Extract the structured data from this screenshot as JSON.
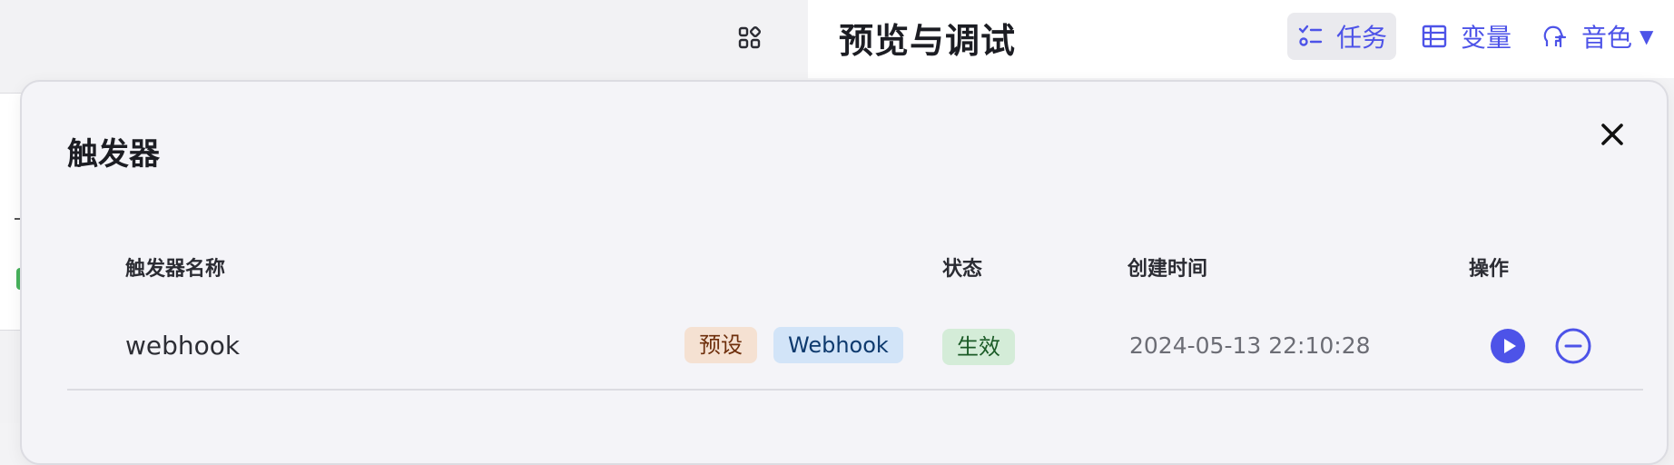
{
  "header": {
    "title": "预览与调试",
    "tools": [
      {
        "label": "任务",
        "icon": "task-list-icon"
      },
      {
        "label": "变量",
        "icon": "table-icon"
      },
      {
        "label": "音色",
        "icon": "voice-icon"
      }
    ]
  },
  "modal": {
    "title": "触发器",
    "columns": {
      "name": "触发器名称",
      "status": "状态",
      "created": "创建时间",
      "actions": "操作"
    },
    "rows": [
      {
        "name": "webhook",
        "tags": [
          "预设",
          "Webhook"
        ],
        "status": "生效",
        "created": "2024-05-13 22:10:28"
      }
    ]
  },
  "colors": {
    "accent": "#4d53e8",
    "tag_preset_bg": "#f5e1d2",
    "tag_webhook_bg": "#d2e4f8",
    "status_bg": "#d4ecd8"
  }
}
